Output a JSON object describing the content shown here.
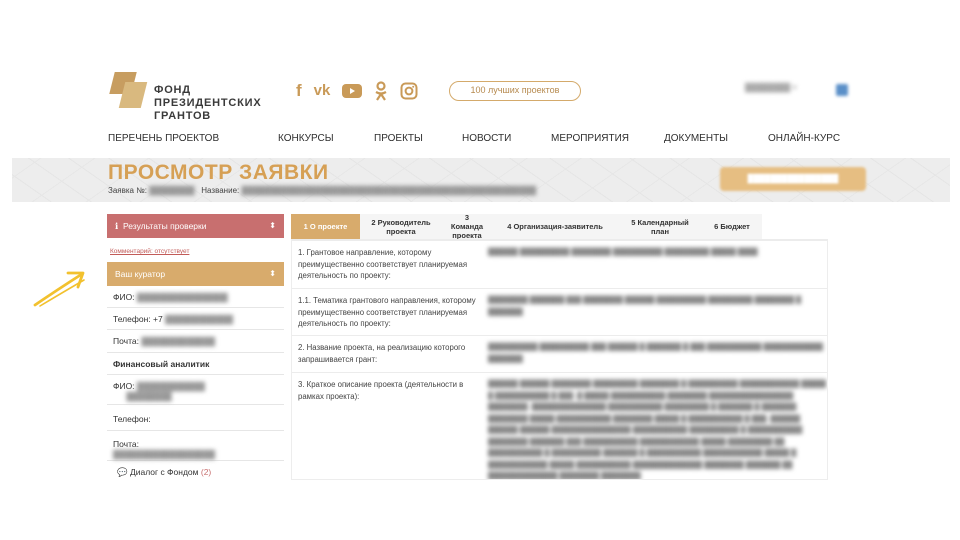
{
  "brand": {
    "line1": "ФОНД",
    "line2": "ПРЕЗИДЕНТСКИХ",
    "line3": "ГРАНТОВ"
  },
  "social_icons": [
    "facebook-icon",
    "vk-icon",
    "youtube-icon",
    "odnoklassniki-icon",
    "instagram-icon"
  ],
  "best_projects_label": "100 лучших проектов",
  "nav": [
    "ПЕРЕЧЕНЬ ПРОЕКТОВ",
    "КОНКУРСЫ",
    "ПРОЕКТЫ",
    "НОВОСТИ",
    "МЕРОПРИЯТИЯ",
    "ДОКУМЕНТЫ",
    "ОНЛАЙН-КУРС"
  ],
  "banner": {
    "title": "ПРОСМОТР ЗАЯВКИ",
    "application_label": "Заявка №:",
    "name_label": "Название:"
  },
  "sidebar": {
    "results_label": "Результаты проверки",
    "comment_label": "Комментарий: отсутствует",
    "curator_label": "Ваш куратор",
    "fio_label": "ФИО:",
    "phone_label": "Телефон: +7",
    "mail_label": "Почта:",
    "analyst_label": "Финансовый аналитик",
    "fio2_label": "ФИО:",
    "phone2_label": "Телефон:",
    "mail2_label": "Почта:",
    "dialog_label": "Диалог с Фондом",
    "dialog_count": "(2)"
  },
  "tabs": [
    "1 О проекте",
    "2 Руководитель проекта",
    "3 Команда проекта",
    "4 Организация-заявитель",
    "5 Календарный план",
    "6 Бюджет"
  ],
  "questions": [
    "1. Грантовое направление, которому преимущественно соответствует планируемая деятельность по проекту:",
    "1.1. Тематика грантового направления, которому преимущественно соответствует планируемая деятельность по проекту:",
    "2. Название проекта, на реализацию которого запрашивается грант:",
    "3. Краткое описание проекта (деятельности в рамках проекта):"
  ],
  "colors": {
    "gold": "#d8ab6c",
    "red_header": "#c86f6f",
    "arrow": "#f2c12e"
  }
}
